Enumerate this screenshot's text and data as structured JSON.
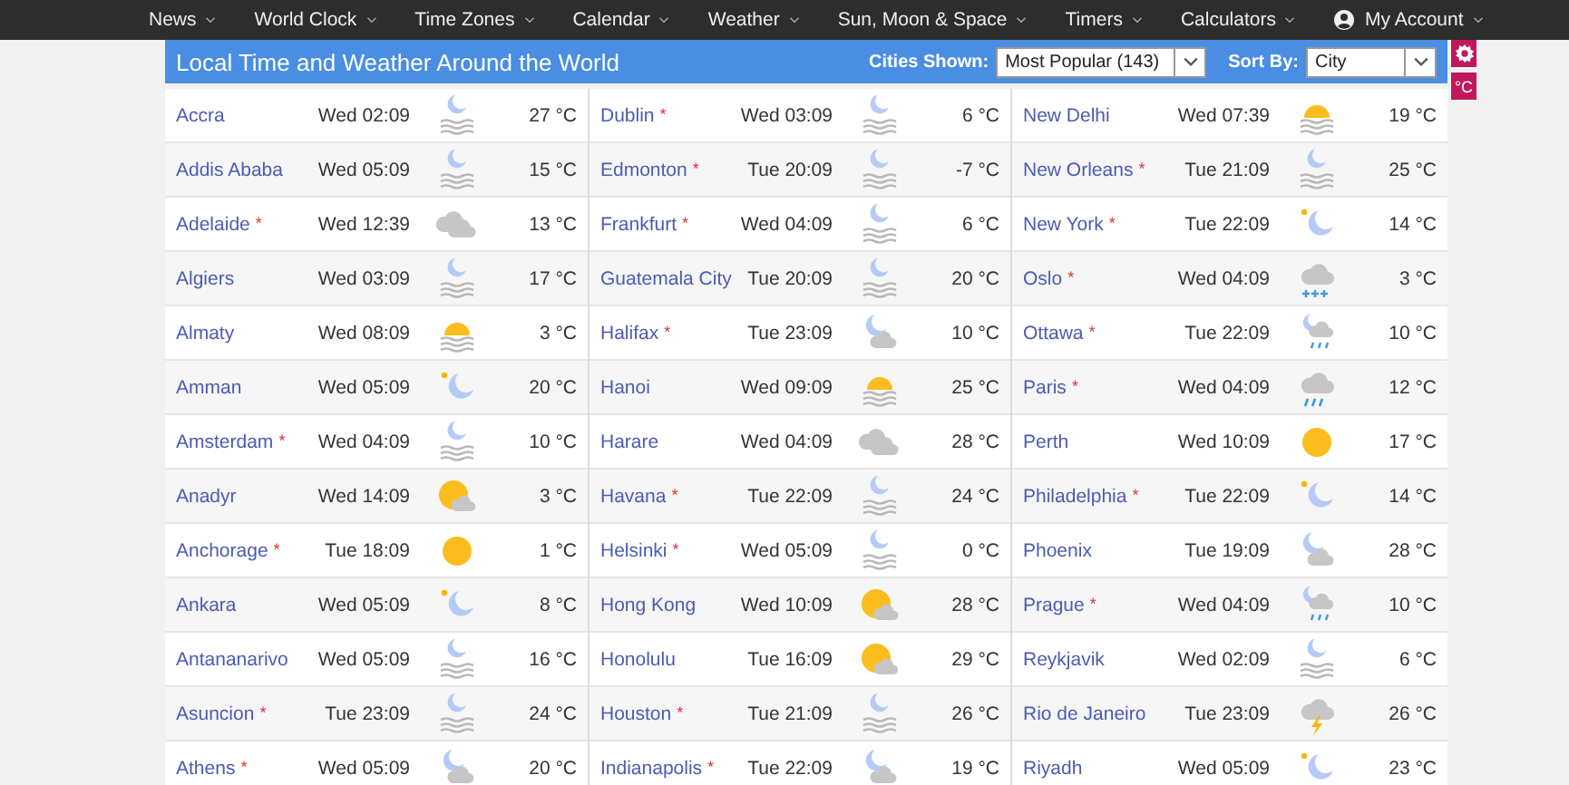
{
  "nav": {
    "items": [
      {
        "label": "News"
      },
      {
        "label": "World Clock"
      },
      {
        "label": "Time Zones"
      },
      {
        "label": "Calendar"
      },
      {
        "label": "Weather"
      },
      {
        "label": "Sun, Moon & Space"
      },
      {
        "label": "Timers"
      },
      {
        "label": "Calculators"
      },
      {
        "label": "My Account",
        "kind": "account"
      }
    ]
  },
  "header": {
    "title": "Local Time and Weather Around the World",
    "cities_label": "Cities Shown:",
    "cities_value": "Most Popular (143)",
    "sort_label": "Sort By:",
    "sort_value": "City",
    "unit": "°C"
  },
  "columns": [
    {
      "rows": [
        {
          "city": "Accra",
          "time": "Wed 02:09",
          "kind": "moonfog",
          "temp": "27 °C"
        },
        {
          "city": "Addis Ababa",
          "time": "Wed 05:09",
          "kind": "moonfog",
          "temp": "15 °C"
        },
        {
          "city": "Adelaide",
          "mark": "*",
          "time": "Wed 12:39",
          "kind": "cloudy",
          "temp": "13 °C"
        },
        {
          "city": "Algiers",
          "time": "Wed 03:09",
          "kind": "moonfog",
          "temp": "17 °C"
        },
        {
          "city": "Almaty",
          "time": "Wed 08:09",
          "kind": "sunfog",
          "temp": "3 °C"
        },
        {
          "city": "Amman",
          "time": "Wed 05:09",
          "kind": "moonstar",
          "temp": "20 °C"
        },
        {
          "city": "Amsterdam",
          "mark": "*",
          "time": "Wed 04:09",
          "kind": "moonfog",
          "temp": "10 °C"
        },
        {
          "city": "Anadyr",
          "time": "Wed 14:09",
          "kind": "suncloud",
          "temp": "3 °C"
        },
        {
          "city": "Anchorage",
          "mark": "*",
          "time": "Tue 18:09",
          "kind": "sunny",
          "temp": "1 °C"
        },
        {
          "city": "Ankara",
          "time": "Wed 05:09",
          "kind": "moonstar",
          "temp": "8 °C"
        },
        {
          "city": "Antananarivo",
          "time": "Wed 05:09",
          "kind": "moonfog",
          "temp": "16 °C"
        },
        {
          "city": "Asuncion",
          "mark": "*",
          "time": "Tue 23:09",
          "kind": "moonfog",
          "temp": "24 °C"
        },
        {
          "city": "Athens",
          "mark": "*",
          "time": "Wed 05:09",
          "kind": "mooncloud",
          "temp": "20 °C"
        }
      ]
    },
    {
      "rows": [
        {
          "city": "Dublin",
          "mark": "*",
          "time": "Wed 03:09",
          "kind": "moonfog",
          "temp": "6 °C"
        },
        {
          "city": "Edmonton",
          "mark": "*",
          "time": "Tue 20:09",
          "kind": "moonfog",
          "temp": "-7 °C"
        },
        {
          "city": "Frankfurt",
          "mark": "*",
          "time": "Wed 04:09",
          "kind": "moonfog",
          "temp": "6 °C"
        },
        {
          "city": "Guatemala City",
          "time": "Tue 20:09",
          "kind": "moonfog",
          "temp": "20 °C"
        },
        {
          "city": "Halifax",
          "mark": "*",
          "time": "Tue 23:09",
          "kind": "mooncloud",
          "temp": "10 °C"
        },
        {
          "city": "Hanoi",
          "time": "Wed 09:09",
          "kind": "sunfog",
          "temp": "25 °C"
        },
        {
          "city": "Harare",
          "time": "Wed 04:09",
          "kind": "cloudy",
          "temp": "28 °C"
        },
        {
          "city": "Havana",
          "mark": "*",
          "time": "Tue 22:09",
          "kind": "moonfog",
          "temp": "24 °C"
        },
        {
          "city": "Helsinki",
          "mark": "*",
          "time": "Wed 05:09",
          "kind": "moonfog",
          "temp": "0 °C"
        },
        {
          "city": "Hong Kong",
          "time": "Wed 10:09",
          "kind": "suncloud",
          "temp": "28 °C"
        },
        {
          "city": "Honolulu",
          "time": "Tue 16:09",
          "kind": "suncloud",
          "temp": "29 °C"
        },
        {
          "city": "Houston",
          "mark": "*",
          "time": "Tue 21:09",
          "kind": "moonfog",
          "temp": "26 °C"
        },
        {
          "city": "Indianapolis",
          "mark": "*",
          "time": "Tue 22:09",
          "kind": "mooncloud",
          "temp": "19 °C"
        }
      ]
    },
    {
      "rows": [
        {
          "city": "New Delhi",
          "time": "Wed 07:39",
          "kind": "sunfog",
          "temp": "19 °C"
        },
        {
          "city": "New Orleans",
          "mark": "*",
          "time": "Tue 21:09",
          "kind": "moonfog",
          "temp": "25 °C"
        },
        {
          "city": "New York",
          "mark": "*",
          "time": "Tue 22:09",
          "kind": "moonstar",
          "temp": "14 °C"
        },
        {
          "city": "Oslo",
          "mark": "*",
          "time": "Wed 04:09",
          "kind": "sleet",
          "temp": "3 °C"
        },
        {
          "city": "Ottawa",
          "mark": "*",
          "time": "Tue 22:09",
          "kind": "moonrain",
          "temp": "10 °C"
        },
        {
          "city": "Paris",
          "mark": "*",
          "time": "Wed 04:09",
          "kind": "rain",
          "temp": "12 °C"
        },
        {
          "city": "Perth",
          "time": "Wed 10:09",
          "kind": "sunny",
          "temp": "17 °C"
        },
        {
          "city": "Philadelphia",
          "mark": "*",
          "time": "Tue 22:09",
          "kind": "moonstar",
          "temp": "14 °C"
        },
        {
          "city": "Phoenix",
          "time": "Tue 19:09",
          "kind": "mooncloud",
          "temp": "28 °C"
        },
        {
          "city": "Prague",
          "mark": "*",
          "time": "Wed 04:09",
          "kind": "moonrain",
          "temp": "10 °C"
        },
        {
          "city": "Reykjavik",
          "time": "Wed 02:09",
          "kind": "moonfog",
          "temp": "6 °C"
        },
        {
          "city": "Rio de Janeiro",
          "time": "Tue 23:09",
          "kind": "thunder",
          "temp": "26 °C"
        },
        {
          "city": "Riyadh",
          "time": "Wed 05:09",
          "kind": "moonstar",
          "temp": "23 °C"
        }
      ]
    }
  ]
}
